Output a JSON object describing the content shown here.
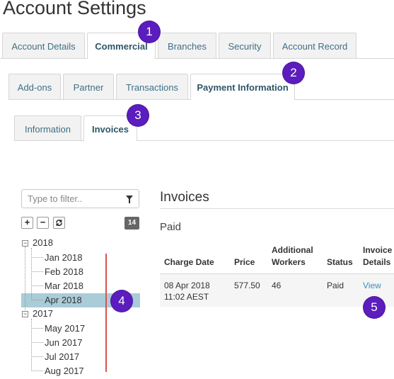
{
  "page": {
    "title": "Account Settings"
  },
  "tabs_level1": [
    {
      "label": "Account Details",
      "active": false
    },
    {
      "label": "Commercial",
      "active": true
    },
    {
      "label": "Branches",
      "active": false
    },
    {
      "label": "Security",
      "active": false
    },
    {
      "label": "Account Record",
      "active": false
    }
  ],
  "tabs_level2": [
    {
      "label": "Add-ons",
      "active": false
    },
    {
      "label": "Partner",
      "active": false
    },
    {
      "label": "Transactions",
      "active": false
    },
    {
      "label": "Payment Information",
      "active": true
    }
  ],
  "tabs_level3": [
    {
      "label": "Information",
      "active": false
    },
    {
      "label": "Invoices",
      "active": true
    }
  ],
  "callouts": [
    "1",
    "2",
    "3",
    "4",
    "5"
  ],
  "filter": {
    "placeholder": "Type to filter..",
    "icon": "filter-icon"
  },
  "tree_toolbar": {
    "expand": "+",
    "collapse": "−",
    "refresh_icon": "refresh-icon",
    "count": "14"
  },
  "tree": {
    "years": [
      {
        "label": "2018",
        "months": [
          "Jan 2018",
          "Feb 2018",
          "Mar 2018",
          "Apr 2018"
        ],
        "selected": "Apr 2018"
      },
      {
        "label": "2017",
        "months": [
          "May 2017",
          "Jun 2017",
          "Jul 2017",
          "Aug 2017"
        ]
      }
    ]
  },
  "invoices": {
    "title": "Invoices",
    "subtitle": "Paid",
    "columns": {
      "charge_date": "Charge Date",
      "price": "Price",
      "additional_workers_1": "Additional",
      "additional_workers_2": "Workers",
      "status": "Status",
      "invoice_details_1": "Invoice",
      "invoice_details_2": "Details"
    },
    "rows": [
      {
        "date": "08 Apr 2018",
        "time": "11:02 AEST",
        "price": "577.50",
        "workers": "46",
        "status": "Paid",
        "details": "View"
      }
    ]
  },
  "colors": {
    "callout": "#5b1dbd",
    "selection": "#a9ccd8",
    "link": "#3a8fc1",
    "marker": "#d9534f"
  }
}
